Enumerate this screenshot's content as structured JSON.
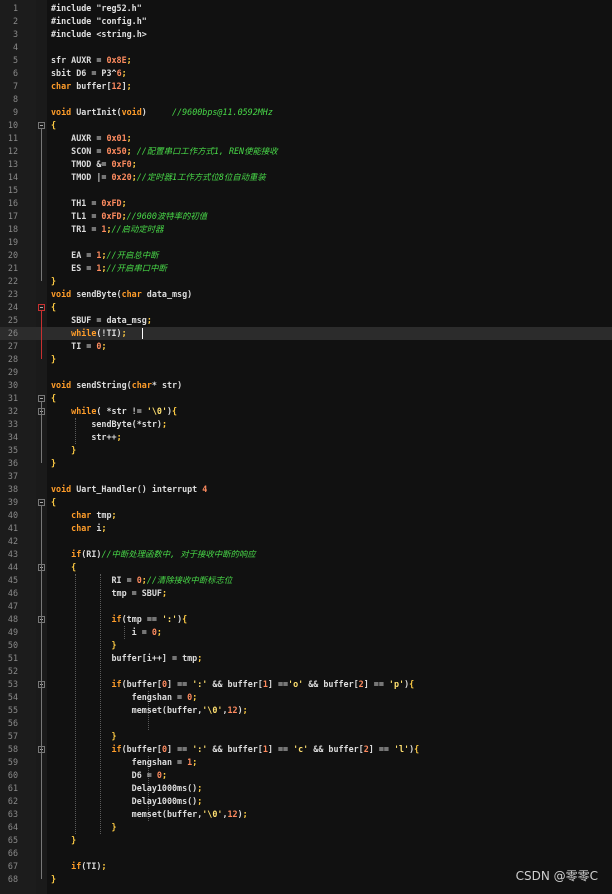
{
  "lines": [
    {
      "n": "1",
      "t": [
        [
          "pp",
          "#include \"reg52.h\""
        ]
      ]
    },
    {
      "n": "2",
      "t": [
        [
          "pp",
          "#include \"config.h\""
        ]
      ]
    },
    {
      "n": "3",
      "t": [
        [
          "pp",
          "#include <string.h>"
        ]
      ]
    },
    {
      "n": "4",
      "t": []
    },
    {
      "n": "5",
      "t": [
        [
          "",
          "sfr AUXR = "
        ],
        [
          "num",
          "0x8E"
        ],
        [
          "punc",
          ";"
        ]
      ]
    },
    {
      "n": "6",
      "t": [
        [
          "",
          "sbit D6 = P3^"
        ],
        [
          "num",
          "6"
        ],
        [
          "punc",
          ";"
        ]
      ]
    },
    {
      "n": "7",
      "t": [
        [
          "kw",
          "char"
        ],
        [
          "",
          " buffer["
        ],
        [
          "num",
          "12"
        ],
        [
          "",
          "]"
        ],
        [
          "punc",
          ";"
        ]
      ]
    },
    {
      "n": "8",
      "t": []
    },
    {
      "n": "9",
      "t": [
        [
          "kw",
          "void"
        ],
        [
          "",
          " UartInit("
        ],
        [
          "kw",
          "void"
        ],
        [
          "",
          ")     "
        ],
        [
          "cmt",
          "//9600bps@11.0592MHz"
        ]
      ]
    },
    {
      "n": "10",
      "t": [
        [
          "punc",
          "{"
        ]
      ]
    },
    {
      "n": "11",
      "t": [
        [
          "",
          "    AUXR = "
        ],
        [
          "num",
          "0x01"
        ],
        [
          "punc",
          ";"
        ]
      ]
    },
    {
      "n": "12",
      "t": [
        [
          "",
          "    SCON = "
        ],
        [
          "num",
          "0x50"
        ],
        [
          "punc",
          ";"
        ],
        [
          "",
          " "
        ],
        [
          "cmt",
          "//配置串口工作方式1, REN使能接收"
        ]
      ]
    },
    {
      "n": "13",
      "t": [
        [
          "",
          "    TMOD &= "
        ],
        [
          "num",
          "0xF0"
        ],
        [
          "punc",
          ";"
        ]
      ]
    },
    {
      "n": "14",
      "t": [
        [
          "",
          "    TMOD |= "
        ],
        [
          "num",
          "0x20"
        ],
        [
          "punc",
          ";"
        ],
        [
          "cmt",
          "//定时器1工作方式位8位自动重装"
        ]
      ]
    },
    {
      "n": "15",
      "t": []
    },
    {
      "n": "16",
      "t": [
        [
          "",
          "    TH1 = "
        ],
        [
          "num",
          "0xFD"
        ],
        [
          "punc",
          ";"
        ]
      ]
    },
    {
      "n": "17",
      "t": [
        [
          "",
          "    TL1 = "
        ],
        [
          "num",
          "0xFD"
        ],
        [
          "punc",
          ";"
        ],
        [
          "cmt",
          "//9600波特率的初值"
        ]
      ]
    },
    {
      "n": "18",
      "t": [
        [
          "",
          "    TR1 = "
        ],
        [
          "num",
          "1"
        ],
        [
          "punc",
          ";"
        ],
        [
          "cmt",
          "//启动定时器"
        ]
      ]
    },
    {
      "n": "19",
      "t": []
    },
    {
      "n": "20",
      "t": [
        [
          "",
          "    EA = "
        ],
        [
          "num",
          "1"
        ],
        [
          "punc",
          ";"
        ],
        [
          "cmt",
          "//开启总中断"
        ]
      ]
    },
    {
      "n": "21",
      "t": [
        [
          "",
          "    ES = "
        ],
        [
          "num",
          "1"
        ],
        [
          "punc",
          ";"
        ],
        [
          "cmt",
          "//开启串口中断"
        ]
      ]
    },
    {
      "n": "22",
      "t": [
        [
          "punc",
          "}"
        ]
      ]
    },
    {
      "n": "23",
      "t": [
        [
          "kw",
          "void"
        ],
        [
          "",
          " sendByte("
        ],
        [
          "kw",
          "char"
        ],
        [
          "",
          " data_msg)"
        ]
      ]
    },
    {
      "n": "24",
      "t": [
        [
          "punc",
          "{"
        ]
      ]
    },
    {
      "n": "25",
      "t": [
        [
          "",
          "    SBUF = data_msg"
        ],
        [
          "punc",
          ";"
        ]
      ]
    },
    {
      "n": "26",
      "t": [
        [
          "",
          "    "
        ],
        [
          "kw",
          "while"
        ],
        [
          "",
          "(!TI)"
        ],
        [
          "punc",
          ";"
        ]
      ]
    },
    {
      "n": "27",
      "t": [
        [
          "",
          "    TI = "
        ],
        [
          "num",
          "0"
        ],
        [
          "punc",
          ";"
        ]
      ]
    },
    {
      "n": "28",
      "t": [
        [
          "punc",
          "}"
        ]
      ]
    },
    {
      "n": "29",
      "t": []
    },
    {
      "n": "30",
      "t": [
        [
          "kw",
          "void"
        ],
        [
          "",
          " sendString("
        ],
        [
          "kw",
          "char"
        ],
        [
          "",
          "* str)"
        ]
      ]
    },
    {
      "n": "31",
      "t": [
        [
          "punc",
          "{"
        ]
      ]
    },
    {
      "n": "32",
      "t": [
        [
          "",
          "    "
        ],
        [
          "kw",
          "while"
        ],
        [
          "",
          "( *str != "
        ],
        [
          "str",
          "'\\0'"
        ],
        [
          "",
          ")"
        ],
        [
          "punc",
          "{"
        ]
      ]
    },
    {
      "n": "33",
      "t": [
        [
          "",
          "        sendByte(*str)"
        ],
        [
          "punc",
          ";"
        ]
      ]
    },
    {
      "n": "34",
      "t": [
        [
          "",
          "        str++"
        ],
        [
          "punc",
          ";"
        ]
      ]
    },
    {
      "n": "35",
      "t": [
        [
          "",
          "    "
        ],
        [
          "punc",
          "}"
        ]
      ]
    },
    {
      "n": "36",
      "t": [
        [
          "punc",
          "}"
        ]
      ]
    },
    {
      "n": "37",
      "t": []
    },
    {
      "n": "38",
      "t": [
        [
          "kw",
          "void"
        ],
        [
          "",
          " Uart_Handler() interrupt "
        ],
        [
          "num",
          "4"
        ]
      ]
    },
    {
      "n": "39",
      "t": [
        [
          "punc",
          "{"
        ]
      ]
    },
    {
      "n": "40",
      "t": [
        [
          "",
          "    "
        ],
        [
          "kw",
          "char"
        ],
        [
          "",
          " tmp"
        ],
        [
          "punc",
          ";"
        ]
      ]
    },
    {
      "n": "41",
      "t": [
        [
          "",
          "    "
        ],
        [
          "kw",
          "char"
        ],
        [
          "",
          " i"
        ],
        [
          "punc",
          ";"
        ]
      ]
    },
    {
      "n": "42",
      "t": []
    },
    {
      "n": "43",
      "t": [
        [
          "",
          "    "
        ],
        [
          "kw",
          "if"
        ],
        [
          "",
          "(RI)"
        ],
        [
          "cmt",
          "//中断处理函数中, 对于接收中断的响应"
        ]
      ]
    },
    {
      "n": "44",
      "t": [
        [
          "",
          "    "
        ],
        [
          "punc",
          "{"
        ]
      ]
    },
    {
      "n": "45",
      "t": [
        [
          "",
          "            RI = "
        ],
        [
          "num",
          "0"
        ],
        [
          "punc",
          ";"
        ],
        [
          "cmt",
          "//清除接收中断标志位"
        ]
      ]
    },
    {
      "n": "46",
      "t": [
        [
          "",
          "            tmp = SBUF"
        ],
        [
          "punc",
          ";"
        ]
      ]
    },
    {
      "n": "47",
      "t": []
    },
    {
      "n": "48",
      "t": [
        [
          "",
          "            "
        ],
        [
          "kw",
          "if"
        ],
        [
          "",
          "(tmp == "
        ],
        [
          "str",
          "':'"
        ],
        [
          "",
          ")"
        ],
        [
          "punc",
          "{"
        ]
      ]
    },
    {
      "n": "49",
      "t": [
        [
          "",
          "                i = "
        ],
        [
          "num",
          "0"
        ],
        [
          "punc",
          ";"
        ]
      ]
    },
    {
      "n": "50",
      "t": [
        [
          "",
          "            "
        ],
        [
          "punc",
          "}"
        ]
      ]
    },
    {
      "n": "51",
      "t": [
        [
          "",
          "            buffer[i++] = tmp"
        ],
        [
          "punc",
          ";"
        ]
      ]
    },
    {
      "n": "52",
      "t": []
    },
    {
      "n": "53",
      "t": [
        [
          "",
          "            "
        ],
        [
          "kw",
          "if"
        ],
        [
          "",
          "(buffer["
        ],
        [
          "num",
          "0"
        ],
        [
          "",
          "] == "
        ],
        [
          "str",
          "':'"
        ],
        [
          "",
          " && buffer["
        ],
        [
          "num",
          "1"
        ],
        [
          "",
          "] =="
        ],
        [
          "str",
          "'o'"
        ],
        [
          "",
          " && buffer["
        ],
        [
          "num",
          "2"
        ],
        [
          "",
          "] == "
        ],
        [
          "str",
          "'p'"
        ],
        [
          "",
          ")"
        ],
        [
          "punc",
          "{"
        ]
      ]
    },
    {
      "n": "54",
      "t": [
        [
          "",
          "                fengshan = "
        ],
        [
          "num",
          "0"
        ],
        [
          "punc",
          ";"
        ]
      ]
    },
    {
      "n": "55",
      "t": [
        [
          "",
          "                memset(buffer,"
        ],
        [
          "str",
          "'\\0'"
        ],
        [
          "",
          ","
        ],
        [
          "num",
          "12"
        ],
        [
          "",
          ")"
        ],
        [
          "punc",
          ";"
        ]
      ]
    },
    {
      "n": "56",
      "t": []
    },
    {
      "n": "57",
      "t": [
        [
          "",
          "            "
        ],
        [
          "punc",
          "}"
        ]
      ]
    },
    {
      "n": "58",
      "t": [
        [
          "",
          "            "
        ],
        [
          "kw",
          "if"
        ],
        [
          "",
          "(buffer["
        ],
        [
          "num",
          "0"
        ],
        [
          "",
          "] == "
        ],
        [
          "str",
          "':'"
        ],
        [
          "",
          " && buffer["
        ],
        [
          "num",
          "1"
        ],
        [
          "",
          "] == "
        ],
        [
          "str",
          "'c'"
        ],
        [
          "",
          " && buffer["
        ],
        [
          "num",
          "2"
        ],
        [
          "",
          "] == "
        ],
        [
          "str",
          "'l'"
        ],
        [
          "",
          ")"
        ],
        [
          "punc",
          "{"
        ]
      ]
    },
    {
      "n": "59",
      "t": [
        [
          "",
          "                fengshan = "
        ],
        [
          "num",
          "1"
        ],
        [
          "punc",
          ";"
        ]
      ]
    },
    {
      "n": "60",
      "t": [
        [
          "",
          "                D6 = "
        ],
        [
          "num",
          "0"
        ],
        [
          "punc",
          ";"
        ]
      ]
    },
    {
      "n": "61",
      "t": [
        [
          "",
          "                Delay1000ms()"
        ],
        [
          "punc",
          ";"
        ]
      ]
    },
    {
      "n": "62",
      "t": [
        [
          "",
          "                Delay1000ms()"
        ],
        [
          "punc",
          ";"
        ]
      ]
    },
    {
      "n": "63",
      "t": [
        [
          "",
          "                memset(buffer,"
        ],
        [
          "str",
          "'\\0'"
        ],
        [
          "",
          ","
        ],
        [
          "num",
          "12"
        ],
        [
          "",
          ")"
        ],
        [
          "punc",
          ";"
        ]
      ]
    },
    {
      "n": "64",
      "t": [
        [
          "",
          "            "
        ],
        [
          "punc",
          "}"
        ]
      ]
    },
    {
      "n": "65",
      "t": [
        [
          "",
          "    "
        ],
        [
          "punc",
          "}"
        ]
      ]
    },
    {
      "n": "66",
      "t": []
    },
    {
      "n": "67",
      "t": [
        [
          "",
          "    "
        ],
        [
          "kw",
          "if"
        ],
        [
          "",
          "(TI)"
        ],
        [
          "punc",
          ";"
        ]
      ]
    },
    {
      "n": "68",
      "t": [
        [
          "punc",
          "}"
        ]
      ]
    }
  ],
  "cursor_line": "26",
  "fold_markers": [
    "10",
    "24",
    "31",
    "32",
    "39",
    "44",
    "48",
    "53",
    "58"
  ],
  "watermark": "CSDN @零零C"
}
